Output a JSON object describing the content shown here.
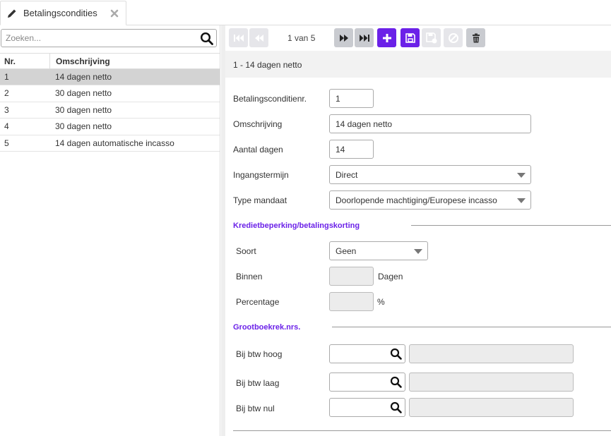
{
  "tab": {
    "label": "Betalingscondities",
    "icon": "pencil-icon",
    "close_icon": "close-icon"
  },
  "search": {
    "placeholder": "Zoeken...",
    "value": "",
    "icon": "search-icon"
  },
  "list": {
    "columns": [
      "Nr.",
      "Omschrijving"
    ],
    "rows": [
      {
        "nr": "1",
        "oms": "14 dagen netto",
        "selected": true
      },
      {
        "nr": "2",
        "oms": "30 dagen netto",
        "selected": false
      },
      {
        "nr": "3",
        "oms": "30 dagen netto",
        "selected": false
      },
      {
        "nr": "4",
        "oms": "30 dagen netto",
        "selected": false
      },
      {
        "nr": "5",
        "oms": "14 dagen automatische incasso",
        "selected": false
      }
    ]
  },
  "toolbar": {
    "pager_text": "1 van 5",
    "buttons": [
      "first-icon",
      "previous-icon",
      "next-icon",
      "last-icon",
      "add-icon",
      "save-icon",
      "save-disabled-icon",
      "cancel-icon",
      "delete-icon"
    ],
    "accent": "#6b21e8"
  },
  "record": {
    "header": "1 - 14 dagen netto"
  },
  "form": {
    "nr_label": "Betalingsconditienr.",
    "nr_value": "1",
    "oms_label": "Omschrijving",
    "oms_value": "14 dagen netto",
    "dagen_label": "Aantal dagen",
    "dagen_value": "14",
    "ingang_label": "Ingangstermijn",
    "ingang_value": "Direct",
    "mandaat_label": "Type mandaat",
    "mandaat_value": "Doorlopende machtiging/Europese incasso"
  },
  "krediet": {
    "section_title": "Kredietbeperking/betalingskorting",
    "soort_label": "Soort",
    "soort_value": "Geen",
    "binnen_label": "Binnen",
    "binnen_unit": "Dagen",
    "percentage_label": "Percentage",
    "percentage_unit": "%"
  },
  "grootboek": {
    "section_title": "Grootboekrek.nrs.",
    "hoog_label": "Bij btw hoog",
    "laag_label": "Bij btw laag",
    "nul_label": "Bij btw nul"
  }
}
